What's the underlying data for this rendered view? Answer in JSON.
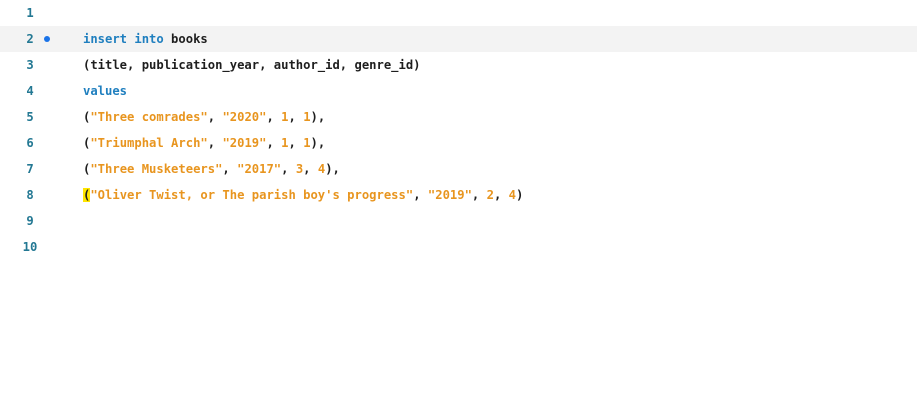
{
  "editor": {
    "line_numbers": [
      "1",
      "2",
      "3",
      "4",
      "5",
      "6",
      "7",
      "8",
      "9",
      "10"
    ],
    "lines": [
      [],
      [
        {
          "cls": "kw",
          "text": "insert into"
        },
        {
          "cls": "plain",
          "text": " books"
        }
      ],
      [
        {
          "cls": "plain",
          "text": "(title, publication_year, author_id, genre_id)"
        }
      ],
      [
        {
          "cls": "kw",
          "text": "values"
        }
      ],
      [
        {
          "cls": "plain",
          "text": "("
        },
        {
          "cls": "str",
          "text": "\"Three comrades\""
        },
        {
          "cls": "plain",
          "text": ", "
        },
        {
          "cls": "str",
          "text": "\"2020\""
        },
        {
          "cls": "plain",
          "text": ", "
        },
        {
          "cls": "num",
          "text": "1"
        },
        {
          "cls": "plain",
          "text": ", "
        },
        {
          "cls": "num",
          "text": "1"
        },
        {
          "cls": "plain",
          "text": "),"
        }
      ],
      [
        {
          "cls": "plain",
          "text": "("
        },
        {
          "cls": "str",
          "text": "\"Triumphal Arch\""
        },
        {
          "cls": "plain",
          "text": ", "
        },
        {
          "cls": "str",
          "text": "\"2019\""
        },
        {
          "cls": "plain",
          "text": ", "
        },
        {
          "cls": "num",
          "text": "1"
        },
        {
          "cls": "plain",
          "text": ", "
        },
        {
          "cls": "num",
          "text": "1"
        },
        {
          "cls": "plain",
          "text": "),"
        }
      ],
      [
        {
          "cls": "plain",
          "text": "("
        },
        {
          "cls": "str",
          "text": "\"Three Musketeers\""
        },
        {
          "cls": "plain",
          "text": ", "
        },
        {
          "cls": "str",
          "text": "\"2017\""
        },
        {
          "cls": "plain",
          "text": ", "
        },
        {
          "cls": "num",
          "text": "3"
        },
        {
          "cls": "plain",
          "text": ", "
        },
        {
          "cls": "num",
          "text": "4"
        },
        {
          "cls": "plain",
          "text": "),"
        }
      ],
      [
        {
          "cls": "bracket-hl",
          "text": "("
        },
        {
          "cls": "str",
          "text": "\"Oliver Twist, or The parish boy's progress\""
        },
        {
          "cls": "plain",
          "text": ", "
        },
        {
          "cls": "str",
          "text": "\"2019\""
        },
        {
          "cls": "plain",
          "text": ", "
        },
        {
          "cls": "num",
          "text": "2"
        },
        {
          "cls": "plain",
          "text": ", "
        },
        {
          "cls": "num",
          "text": "4"
        },
        {
          "cls": "plain",
          "text": ")"
        }
      ],
      [],
      []
    ],
    "current_line_index": 1,
    "marker_line_index": 1
  },
  "colors": {
    "keyword": "#1f7fbf",
    "string": "#e8951f",
    "number": "#e8951f",
    "line_number": "#237893",
    "marker": "#1a73e8",
    "bracket_highlight": "#ffe500",
    "current_line_bg": "#f3f3f3"
  }
}
